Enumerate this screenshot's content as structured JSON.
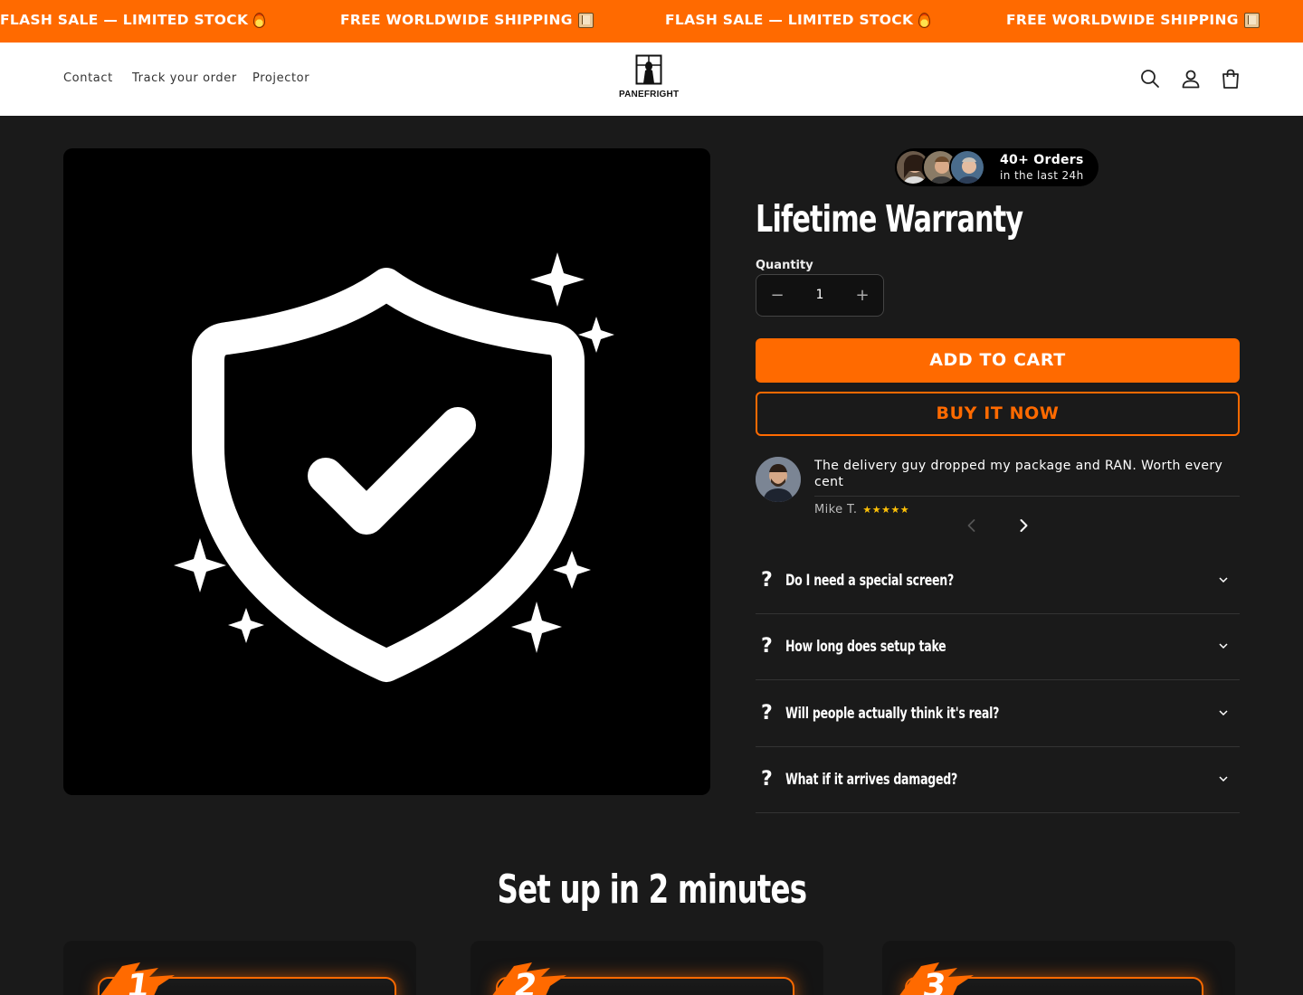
{
  "announcement": {
    "items": [
      {
        "text": "FLASH SALE — LIMITED STOCK",
        "emoji": "fire-emoji"
      },
      {
        "text": "FREE WORLDWIDE SHIPPING",
        "emoji": "package-emoji"
      },
      {
        "text": "FLASH SALE — LIMITED STOCK",
        "emoji": "fire-emoji"
      },
      {
        "text": "FREE WORLDWIDE SHIPPING",
        "emoji": "package-emoji"
      }
    ],
    "background": "#ff6a00"
  },
  "header": {
    "nav": [
      "Contact",
      "Track your order",
      "Projector"
    ],
    "logo_text": "PANEFRIGHT",
    "icons": [
      "search-icon",
      "account-icon",
      "cart-icon"
    ]
  },
  "social_proof": {
    "title": "40+ Orders",
    "subtitle": "in the last 24h"
  },
  "product": {
    "title": "Lifetime Warranty",
    "quantity_label": "Quantity",
    "quantity": "1",
    "decrease_symbol": "−",
    "increase_symbol": "+",
    "add_to_cart": "ADD TO CART",
    "buy_now": "BUY IT NOW",
    "image_icon": "shield-check-icon"
  },
  "review": {
    "text": "The delivery guy dropped my package and RAN. Worth every cent",
    "author": "Mike T.",
    "stars": "★★★★★",
    "rating": 5
  },
  "faqs": [
    {
      "q": "?",
      "text": "Do I need a special screen?"
    },
    {
      "q": "?",
      "text": "How long does setup take"
    },
    {
      "q": "?",
      "text": "Will people actually think it's real?"
    },
    {
      "q": "?",
      "text": "What if it arrives damaged?"
    }
  ],
  "setup": {
    "title": "Set up in 2 minutes",
    "steps": [
      "1",
      "2",
      "3"
    ]
  },
  "colors": {
    "accent": "#ff6a00",
    "page_bg": "#1a1a1a",
    "star": "#ffc107"
  }
}
